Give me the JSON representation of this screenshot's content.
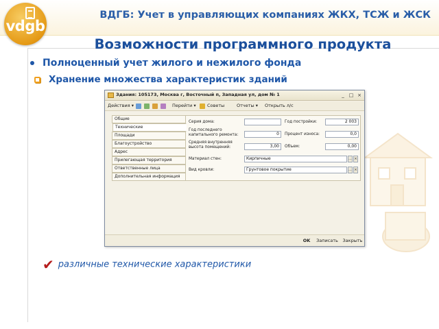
{
  "logo": {
    "text": "vdgb"
  },
  "header": {
    "title": "ВДГБ: Учет в управляющих компаниях ЖКХ, ТСЖ и ЖСК"
  },
  "slide": {
    "title": "Возможности программного продукта",
    "bullet_main": "Полноценный учет жилого и нежилого фонда",
    "bullet_sub": "Хранение множества характеристик зданий",
    "check_text": "различные технические характеристики"
  },
  "window": {
    "title": "Здания: 105173, Москва г, Восточный п, Западная ул, дом № 1",
    "controls": [
      "_",
      "□",
      "×"
    ],
    "toolbar": {
      "actions": "Действия",
      "goto": "Перейти",
      "advice": "Советы",
      "reports": "Отчеты",
      "open_account": "Открыть л/с"
    },
    "tabs": [
      "Общие",
      "Технические",
      "Площади",
      "Благоустройство",
      "Адрес",
      "Прилегающая территория",
      "Ответственные лица",
      "Дополнительная информация"
    ],
    "active_tab": "Технические",
    "fields": {
      "series_label": "Серия дома:",
      "series_value": "",
      "year_built_label": "Год постройки:",
      "year_built_value": "2 003",
      "last_repair_label": "Год последнего капитального ремонта:",
      "last_repair_value": "0",
      "wear_label": "Процент износа:",
      "wear_value": "0,0",
      "avg_height_label": "Средняя внутренняя высота помещений:",
      "avg_height_value": "3,00",
      "volume_label": "Объем:",
      "volume_value": "0,00",
      "wall_material_label": "Материал стен:",
      "wall_material_value": "Кирпичные",
      "roof_type_label": "Вид кровли:",
      "roof_type_value": "Грунтовое покрытие"
    },
    "buttons": {
      "ok": "OK",
      "save": "Записать",
      "close": "Закрыть"
    }
  },
  "colors": {
    "title_blue": "#1b4f9c",
    "accent_orange": "#f0a020",
    "check_red": "#b51c1c"
  }
}
